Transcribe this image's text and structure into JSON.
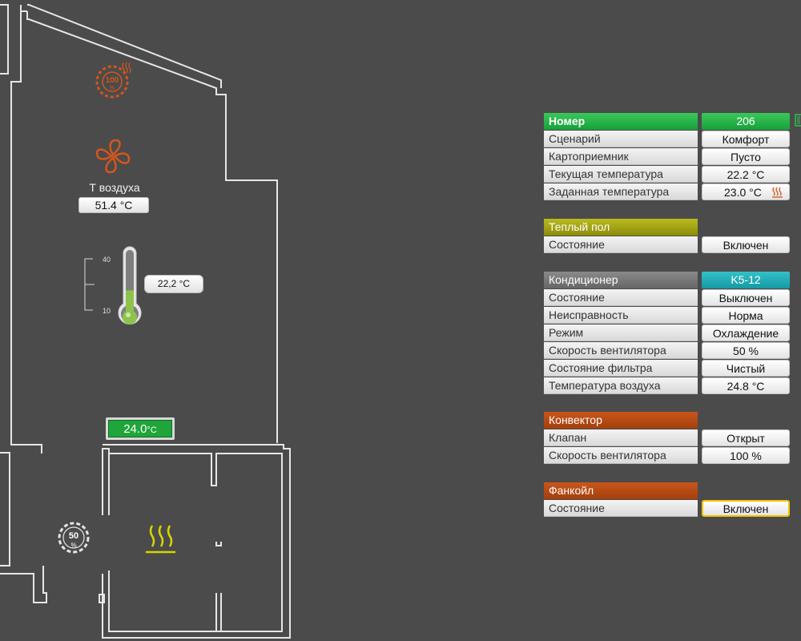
{
  "floorplan": {
    "heater_percent": "100",
    "heater_unit": "%",
    "air_temp_label": "Т воздуха",
    "air_temp_value": "51.4 °C",
    "thermometer_max": "40",
    "thermometer_min": "10",
    "thermometer_value": "22,2 °C",
    "thermometer_level": 0.41,
    "setpoint_value": "24.0",
    "setpoint_unit": "°C",
    "fan_percent": "50",
    "fan_unit": "%"
  },
  "room": {
    "header": "Номер",
    "number": "206",
    "rows": [
      {
        "label": "Сценарий",
        "value": "Комфорт"
      },
      {
        "label": "Картоприемник",
        "value": "Пусто"
      },
      {
        "label": "Текущая температура",
        "value": "22.2 °C"
      },
      {
        "label": "Заданная температура",
        "value": "23.0 °C"
      }
    ]
  },
  "floor_heating": {
    "header": "Теплый пол",
    "rows": [
      {
        "label": "Состояние",
        "value": "Включен"
      }
    ]
  },
  "conditioner": {
    "header": "Кондиционер",
    "model": "K5-12",
    "rows": [
      {
        "label": "Состояние",
        "value": "Выключен"
      },
      {
        "label": "Неисправность",
        "value": "Норма"
      },
      {
        "label": "Режим",
        "value": "Охлаждение"
      },
      {
        "label": "Скорость вентилятора",
        "value": "50 %"
      },
      {
        "label": "Состояние фильтра",
        "value": "Чистый"
      },
      {
        "label": "Температура воздуха",
        "value": "24.8 °C"
      }
    ]
  },
  "convector": {
    "header": "Конвектор",
    "rows": [
      {
        "label": "Клапан",
        "value": "Открыт"
      },
      {
        "label": "Скорость вентилятора",
        "value": "100 %"
      }
    ]
  },
  "fancoil": {
    "header": "Фанкойл",
    "rows": [
      {
        "label": "Состояние",
        "value": "Включен"
      }
    ]
  },
  "colors": {
    "background": "#4b4b4b",
    "heater_orange": "#d4561c",
    "heating_yellow": "#d8d400",
    "room_green": "#22b043",
    "floor_olive": "#a5a514",
    "conditioner_teal": "#1fabb4",
    "convector_rust": "#b44812",
    "selected_border": "#f2c200"
  },
  "icons": [
    "heater-gauge-icon",
    "fan-icon",
    "thermometer-icon",
    "fan-speed-gauge-icon",
    "floor-heating-icon",
    "heating-mini-icon",
    "document-icon"
  ]
}
